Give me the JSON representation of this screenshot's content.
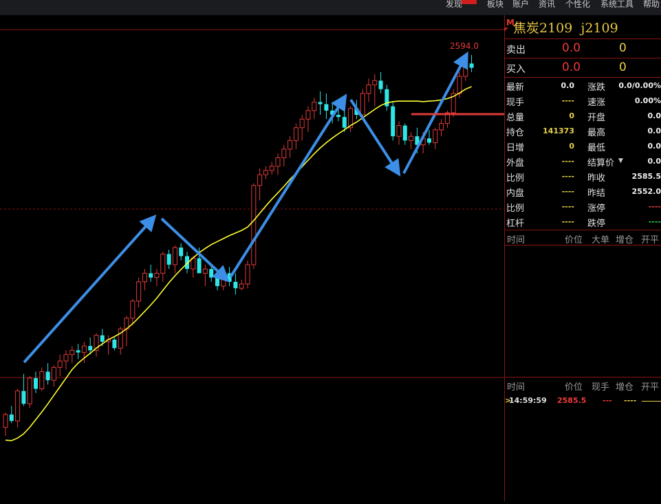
{
  "menu": {
    "discover": "发现",
    "sector": "板块",
    "account": "账户",
    "info": "资讯",
    "personalize": "个性化",
    "tools": "系统工具",
    "help": "帮助"
  },
  "colors": {
    "up": "#e33a3a",
    "down": "#2ee6e6",
    "ma": "#ffff33",
    "arrow": "#3d8ee6",
    "highlight": "#e03a3a",
    "grid": "#8a1414"
  },
  "chart": {
    "high_label": "2594.0"
  },
  "chart_data": {
    "type": "candlestick",
    "ohlc": [
      [
        2510,
        2545,
        2490,
        2540
      ],
      [
        2540,
        2560,
        2520,
        2525
      ],
      [
        2525,
        2600,
        2510,
        2595
      ],
      [
        2595,
        2635,
        2560,
        2565
      ],
      [
        2565,
        2630,
        2555,
        2625
      ],
      [
        2625,
        2640,
        2590,
        2600
      ],
      [
        2600,
        2650,
        2595,
        2640
      ],
      [
        2640,
        2660,
        2610,
        2620
      ],
      [
        2620,
        2655,
        2605,
        2650
      ],
      [
        2650,
        2680,
        2630,
        2665
      ],
      [
        2665,
        2690,
        2645,
        2680
      ],
      [
        2680,
        2700,
        2660,
        2690
      ],
      [
        2690,
        2705,
        2670,
        2685
      ],
      [
        2685,
        2710,
        2660,
        2700
      ],
      [
        2700,
        2720,
        2680,
        2690
      ],
      [
        2690,
        2730,
        2675,
        2725
      ],
      [
        2725,
        2740,
        2700,
        2710
      ],
      [
        2710,
        2725,
        2680,
        2715
      ],
      [
        2715,
        2720,
        2690,
        2695
      ],
      [
        2695,
        2745,
        2680,
        2740
      ],
      [
        2740,
        2770,
        2700,
        2765
      ],
      [
        2765,
        2810,
        2750,
        2805
      ],
      [
        2805,
        2860,
        2790,
        2850
      ],
      [
        2850,
        2880,
        2830,
        2870
      ],
      [
        2870,
        2890,
        2850,
        2860
      ],
      [
        2860,
        2880,
        2840,
        2870
      ],
      [
        2870,
        2920,
        2850,
        2915
      ],
      [
        2915,
        2925,
        2880,
        2890
      ],
      [
        2890,
        2935,
        2870,
        2930
      ],
      [
        2930,
        2940,
        2900,
        2910
      ],
      [
        2910,
        2920,
        2870,
        2880
      ],
      [
        2880,
        2910,
        2860,
        2905
      ],
      [
        2905,
        2930,
        2880,
        2870
      ],
      [
        2870,
        2890,
        2840,
        2880
      ],
      [
        2880,
        2890,
        2850,
        2860
      ],
      [
        2860,
        2875,
        2830,
        2840
      ],
      [
        2840,
        2880,
        2830,
        2870
      ],
      [
        2870,
        2885,
        2840,
        2850
      ],
      [
        2850,
        2870,
        2820,
        2835
      ],
      [
        2835,
        2855,
        2830,
        2845
      ],
      [
        2845,
        2900,
        2835,
        2890
      ],
      [
        2890,
        3080,
        2880,
        3075
      ],
      [
        3075,
        3115,
        3040,
        3100
      ],
      [
        3100,
        3120,
        3090,
        3110
      ],
      [
        3110,
        3130,
        3100,
        3120
      ],
      [
        3120,
        3150,
        3100,
        3140
      ],
      [
        3140,
        3170,
        3120,
        3160
      ],
      [
        3160,
        3190,
        3140,
        3180
      ],
      [
        3180,
        3220,
        3160,
        3210
      ],
      [
        3210,
        3240,
        3180,
        3230
      ],
      [
        3230,
        3260,
        3200,
        3250
      ],
      [
        3250,
        3280,
        3230,
        3270
      ],
      [
        3270,
        3295,
        3240,
        3265
      ],
      [
        3265,
        3290,
        3230,
        3250
      ],
      [
        3250,
        3270,
        3220,
        3240
      ],
      [
        3240,
        3275,
        3225,
        3235
      ],
      [
        3235,
        3250,
        3200,
        3210
      ],
      [
        3210,
        3260,
        3200,
        3255
      ],
      [
        3255,
        3275,
        3230,
        3240
      ],
      [
        3240,
        3300,
        3230,
        3290
      ],
      [
        3290,
        3325,
        3270,
        3310
      ],
      [
        3310,
        3335,
        3260,
        3320
      ],
      [
        3320,
        3340,
        3290,
        3300
      ],
      [
        3300,
        3310,
        3250,
        3260
      ],
      [
        3260,
        3270,
        3180,
        3190
      ],
      [
        3190,
        3225,
        3170,
        3215
      ],
      [
        3215,
        3220,
        3170,
        3180
      ],
      [
        3180,
        3200,
        3160,
        3190
      ],
      [
        3190,
        3210,
        3150,
        3170
      ],
      [
        3170,
        3200,
        3150,
        3185
      ],
      [
        3185,
        3205,
        3170,
        3175
      ],
      [
        3175,
        3210,
        3160,
        3205
      ],
      [
        3205,
        3230,
        3190,
        3220
      ],
      [
        3220,
        3250,
        3210,
        3245
      ],
      [
        3245,
        3300,
        3235,
        3290
      ],
      [
        3290,
        3340,
        3280,
        3330
      ],
      [
        3330,
        3370,
        3320,
        3360
      ],
      [
        3360,
        3380,
        3340,
        3350
      ]
    ],
    "ma": [
      2480,
      2479,
      2485,
      2495,
      2510,
      2528,
      2546,
      2565,
      2585,
      2605,
      2625,
      2645,
      2660,
      2672,
      2683,
      2695,
      2705,
      2715,
      2722,
      2730,
      2740,
      2752,
      2766,
      2781,
      2796,
      2812,
      2830,
      2848,
      2864,
      2879,
      2893,
      2906,
      2918,
      2928,
      2937,
      2944,
      2951,
      2958,
      2964,
      2970,
      2978,
      2993,
      3010,
      3027,
      3043,
      3058,
      3073,
      3089,
      3104,
      3119,
      3134,
      3149,
      3163,
      3175,
      3186,
      3196,
      3205,
      3215,
      3223,
      3233,
      3243,
      3253,
      3262,
      3268,
      3271,
      3272,
      3272,
      3272,
      3272,
      3271,
      3272,
      3273,
      3275,
      3278,
      3283,
      3291,
      3300,
      3306
    ]
  },
  "panel": {
    "code_name": "焦炭2109",
    "code": "j2109",
    "sell": {
      "label": "卖出",
      "price": "0.0",
      "vol": "0"
    },
    "buy": {
      "label": "买入",
      "price": "0.0",
      "vol": "0"
    },
    "rows": [
      {
        "l": "最新",
        "v": "0.0",
        "vc": "#f0f0f0",
        "r": "涨跌",
        "rv": "0.0/0.00%",
        "rc": "#f0f0f0"
      },
      {
        "l": "现手",
        "v": "----",
        "vc": "#e8d24a",
        "r": "速涨",
        "rv": "0.00%",
        "rc": "#f0f0f0"
      },
      {
        "l": "总量",
        "v": "0",
        "vc": "#e8d24a",
        "r": "开盘",
        "rv": "0.0",
        "rc": "#f0f0f0"
      },
      {
        "l": "持仓",
        "v": "141373",
        "vc": "#e8d24a",
        "r": "最高",
        "rv": "0.0",
        "rc": "#f0f0f0"
      },
      {
        "l": "日增",
        "v": "0",
        "vc": "#e8d24a",
        "r": "最低",
        "rv": "0.0",
        "rc": "#f0f0f0"
      },
      {
        "l": "外盘",
        "v": "----",
        "vc": "#e8d24a",
        "r": "结算价",
        "rv": "0.0",
        "rc": "#f0f0f0"
      },
      {
        "l": "比例",
        "v": "----",
        "vc": "#e8d24a",
        "r": "昨收",
        "rv": "2585.5",
        "rc": "#f0f0f0"
      },
      {
        "l": "内盘",
        "v": "----",
        "vc": "#e8d24a",
        "r": "昨结",
        "rv": "2552.0",
        "rc": "#f0f0f0"
      },
      {
        "l": "比例",
        "v": "----",
        "vc": "#e8d24a",
        "r": "涨停",
        "rv": "----",
        "rc": "#e33a3a"
      },
      {
        "l": "杠杆",
        "v": "----",
        "vc": "#e8d24a",
        "r": "跌停",
        "rv": "----",
        "rc": "#2ecc40"
      }
    ],
    "ticks_header": {
      "time": "时间",
      "price": "价位",
      "big": "大单",
      "oi": "增仓",
      "open": "开平"
    },
    "trades_header": {
      "time": "时间",
      "price": "价位",
      "hand": "现手",
      "oi": "增仓",
      "open": "开平"
    },
    "trade": {
      "time": "14:59:59",
      "price": "2585.5",
      "hand": "---",
      "oi": "----"
    }
  }
}
